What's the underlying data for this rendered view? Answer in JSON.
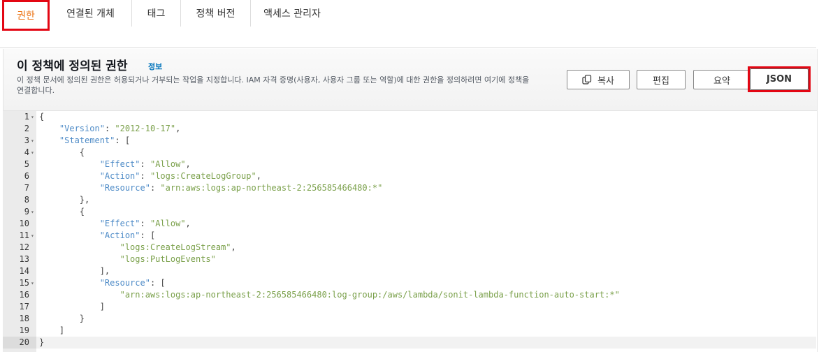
{
  "tabs": [
    {
      "label": "권한",
      "active": true
    },
    {
      "label": "연결된 개체",
      "active": false
    },
    {
      "label": "태그",
      "active": false
    },
    {
      "label": "정책 버전",
      "active": false
    },
    {
      "label": "액세스 관리자",
      "active": false
    }
  ],
  "panel": {
    "title": "이 정책에 정의된 권한",
    "info_link": "정보",
    "description": "이 정책 문서에 정의된 권한은 허용되거나 거부되는 작업을 지정합니다. IAM 자격 증명(사용자, 사용자 그룹 또는 역할)에 대한 권한을 정의하려면 여기에 정책을 연결합니다."
  },
  "buttons": {
    "copy": "복사",
    "edit": "편집",
    "summary": "요약",
    "json": "JSON"
  },
  "editor": {
    "lines": [
      {
        "n": "1",
        "fold": true,
        "text": "{"
      },
      {
        "n": "2",
        "fold": false,
        "text": "    \"Version\": \"2012-10-17\","
      },
      {
        "n": "3",
        "fold": true,
        "text": "    \"Statement\": ["
      },
      {
        "n": "4",
        "fold": true,
        "text": "        {"
      },
      {
        "n": "5",
        "fold": false,
        "text": "            \"Effect\": \"Allow\","
      },
      {
        "n": "6",
        "fold": false,
        "text": "            \"Action\": \"logs:CreateLogGroup\","
      },
      {
        "n": "7",
        "fold": false,
        "text": "            \"Resource\": \"arn:aws:logs:ap-northeast-2:256585466480:*\""
      },
      {
        "n": "8",
        "fold": false,
        "text": "        },"
      },
      {
        "n": "9",
        "fold": true,
        "text": "        {"
      },
      {
        "n": "10",
        "fold": false,
        "text": "            \"Effect\": \"Allow\","
      },
      {
        "n": "11",
        "fold": true,
        "text": "            \"Action\": ["
      },
      {
        "n": "12",
        "fold": false,
        "text": "                \"logs:CreateLogStream\","
      },
      {
        "n": "13",
        "fold": false,
        "text": "                \"logs:PutLogEvents\""
      },
      {
        "n": "14",
        "fold": false,
        "text": "            ],"
      },
      {
        "n": "15",
        "fold": true,
        "text": "            \"Resource\": ["
      },
      {
        "n": "16",
        "fold": false,
        "text": "                \"arn:aws:logs:ap-northeast-2:256585466480:log-group:/aws/lambda/sonit-lambda-function-auto-start:*\""
      },
      {
        "n": "17",
        "fold": false,
        "text": "            ]"
      },
      {
        "n": "18",
        "fold": false,
        "text": "        }"
      },
      {
        "n": "19",
        "fold": false,
        "text": "    ]"
      },
      {
        "n": "20",
        "fold": false,
        "text": "}"
      }
    ],
    "current_line": "20"
  }
}
